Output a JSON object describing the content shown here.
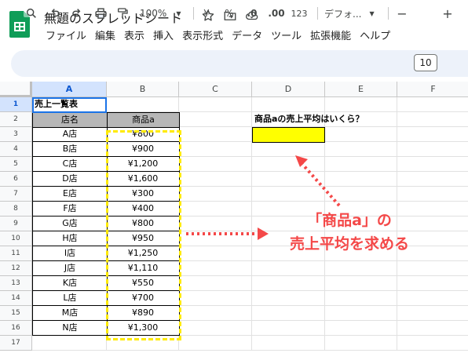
{
  "document": {
    "title": "無題のスプレッドシート"
  },
  "icons": {
    "logo": "sheets-logo-icon",
    "star": "star-icon",
    "move": "move-to-folder-icon",
    "cloud": "cloud-saved-icon"
  },
  "menu": [
    "ファイル",
    "編集",
    "表示",
    "挿入",
    "表示形式",
    "データ",
    "ツール",
    "拡張機能",
    "ヘルプ"
  ],
  "toolbar": {
    "zoom": "100%",
    "currency": "¥",
    "percent": "%",
    "decrease_decimals": ".0",
    "increase_decimals": ".00",
    "number_format": "123",
    "font": "デフォ...",
    "minus": "−",
    "font_size": "10",
    "plus": "+"
  },
  "columns": [
    "A",
    "B",
    "C",
    "D",
    "E",
    "F"
  ],
  "rows": [
    "1",
    "2",
    "3",
    "4",
    "5",
    "6",
    "7",
    "8",
    "9",
    "10",
    "11",
    "12",
    "13",
    "14",
    "15",
    "16",
    "17"
  ],
  "sheet": {
    "a1": "売上一覧表",
    "header_store": "店名",
    "header_product": "商品a",
    "question": "商品aの売上平均はいくら？",
    "stores": [
      "A店",
      "B店",
      "C店",
      "D店",
      "E店",
      "F店",
      "G店",
      "H店",
      "I店",
      "J店",
      "K店",
      "L店",
      "M店",
      "N店"
    ],
    "sales": [
      "¥800",
      "¥900",
      "¥1,200",
      "¥1,600",
      "¥300",
      "¥400",
      "¥800",
      "¥950",
      "¥1,250",
      "¥1,110",
      "¥550",
      "¥700",
      "¥890",
      "¥1,300"
    ]
  },
  "annotation": {
    "line1": "「商品a」の",
    "line2": "売上平均を求める",
    "color": "#f44848"
  },
  "colors": {
    "highlight_cell": "#ffff00",
    "dash_border": "#ffeb00",
    "header_fill": "#b7b7b7",
    "selection": "#1a73e8"
  }
}
